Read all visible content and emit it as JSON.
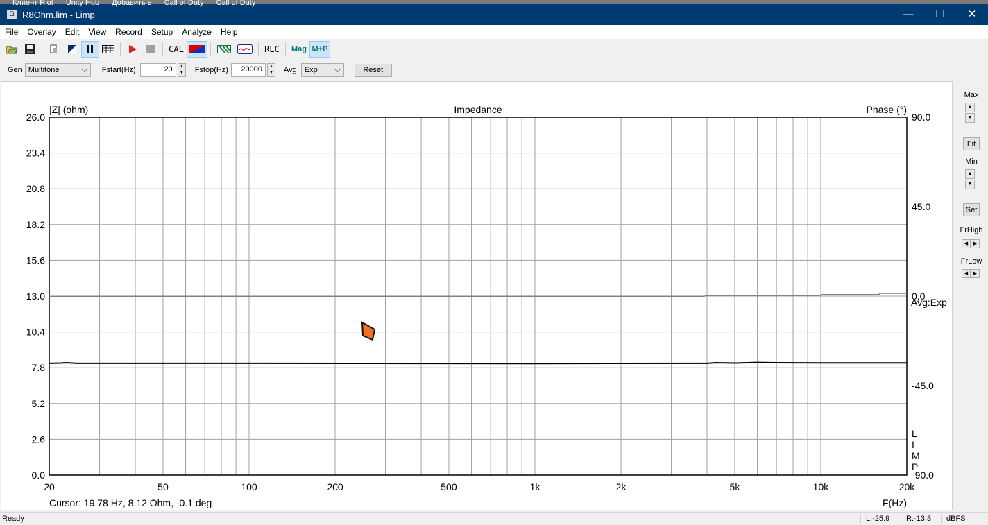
{
  "taskbar_items": [
    "Клиент Riot",
    "Unity Hub",
    "Добавить в",
    "Call of Duty",
    "Call of Duty"
  ],
  "window": {
    "title": "R8Ohm.lim - Limp",
    "minimize": "—",
    "maximize": "☐",
    "close": "✕"
  },
  "menu": [
    "File",
    "Overlay",
    "Edit",
    "View",
    "Record",
    "Setup",
    "Analyze",
    "Help"
  ],
  "toolbar": {
    "cal": "CAL",
    "rlc": "RLC",
    "mag": "Mag",
    "mp": "M+P"
  },
  "controls": {
    "gen_label": "Gen",
    "gen_value": "Multitone",
    "fstart_label": "Fstart(Hz)",
    "fstart_value": "20",
    "fstop_label": "Fstop(Hz)",
    "fstop_value": "20000",
    "avg_label": "Avg",
    "avg_value": "Exp",
    "reset": "Reset"
  },
  "right_panel": {
    "max": "Max",
    "fit": "Fit",
    "min": "Min",
    "set": "Set",
    "frhigh": "FrHigh",
    "frlow": "FrLow"
  },
  "plot": {
    "cursor": "Cursor: 19.78 Hz, 8.12 Ohm, -0.1 deg",
    "avg_note": "Avg:Exp",
    "side_label": [
      "L",
      "I",
      "M",
      "P"
    ]
  },
  "chart_data": {
    "type": "line",
    "title": "Impedance",
    "ylabel": "|Z| (ohm)",
    "y2label": "Phase (°)",
    "xlabel": "F(Hz)",
    "xscale": "log",
    "xlim": [
      20,
      20000
    ],
    "ylim": [
      0,
      26
    ],
    "y2lim": [
      -90,
      90
    ],
    "x_ticks": [
      {
        "v": 20,
        "l": "20"
      },
      {
        "v": 50,
        "l": "50"
      },
      {
        "v": 100,
        "l": "100"
      },
      {
        "v": 200,
        "l": "200"
      },
      {
        "v": 500,
        "l": "500"
      },
      {
        "v": 1000,
        "l": "1k"
      },
      {
        "v": 2000,
        "l": "2k"
      },
      {
        "v": 5000,
        "l": "5k"
      },
      {
        "v": 10000,
        "l": "10k"
      },
      {
        "v": 20000,
        "l": "20k"
      }
    ],
    "y_ticks": [
      "0.0",
      "2.6",
      "5.2",
      "7.8",
      "10.4",
      "13.0",
      "15.6",
      "18.2",
      "20.8",
      "23.4",
      "26.0"
    ],
    "y2_ticks": [
      {
        "v": 90,
        "l": "90.0"
      },
      {
        "v": 45,
        "l": "45.0"
      },
      {
        "v": 0,
        "l": "0.0"
      },
      {
        "v": -45,
        "l": "-45.0"
      },
      {
        "v": -90,
        "l": "-90.0"
      }
    ],
    "series": [
      {
        "name": "Impedance",
        "color": "#000000",
        "x": [
          20,
          22,
          23,
          25,
          100,
          1000,
          4000,
          4300,
          5000,
          6000,
          7000,
          10000,
          20000
        ],
        "y": [
          8.12,
          8.14,
          8.16,
          8.12,
          8.12,
          8.1,
          8.12,
          8.16,
          8.14,
          8.18,
          8.16,
          8.15,
          8.15
        ]
      },
      {
        "name": "Phase",
        "color": "#808080",
        "x": [
          20,
          100,
          1000,
          3900,
          4000,
          10000,
          10100,
          16000,
          16100,
          20000
        ],
        "y": [
          -0.1,
          -0.1,
          -0.1,
          -0.1,
          0.3,
          0.3,
          0.8,
          0.8,
          1.4,
          1.4
        ]
      }
    ]
  },
  "status": {
    "ready": "Ready",
    "left": "L:-25.9",
    "right": "R:-13.3",
    "unit": "dBFS"
  }
}
